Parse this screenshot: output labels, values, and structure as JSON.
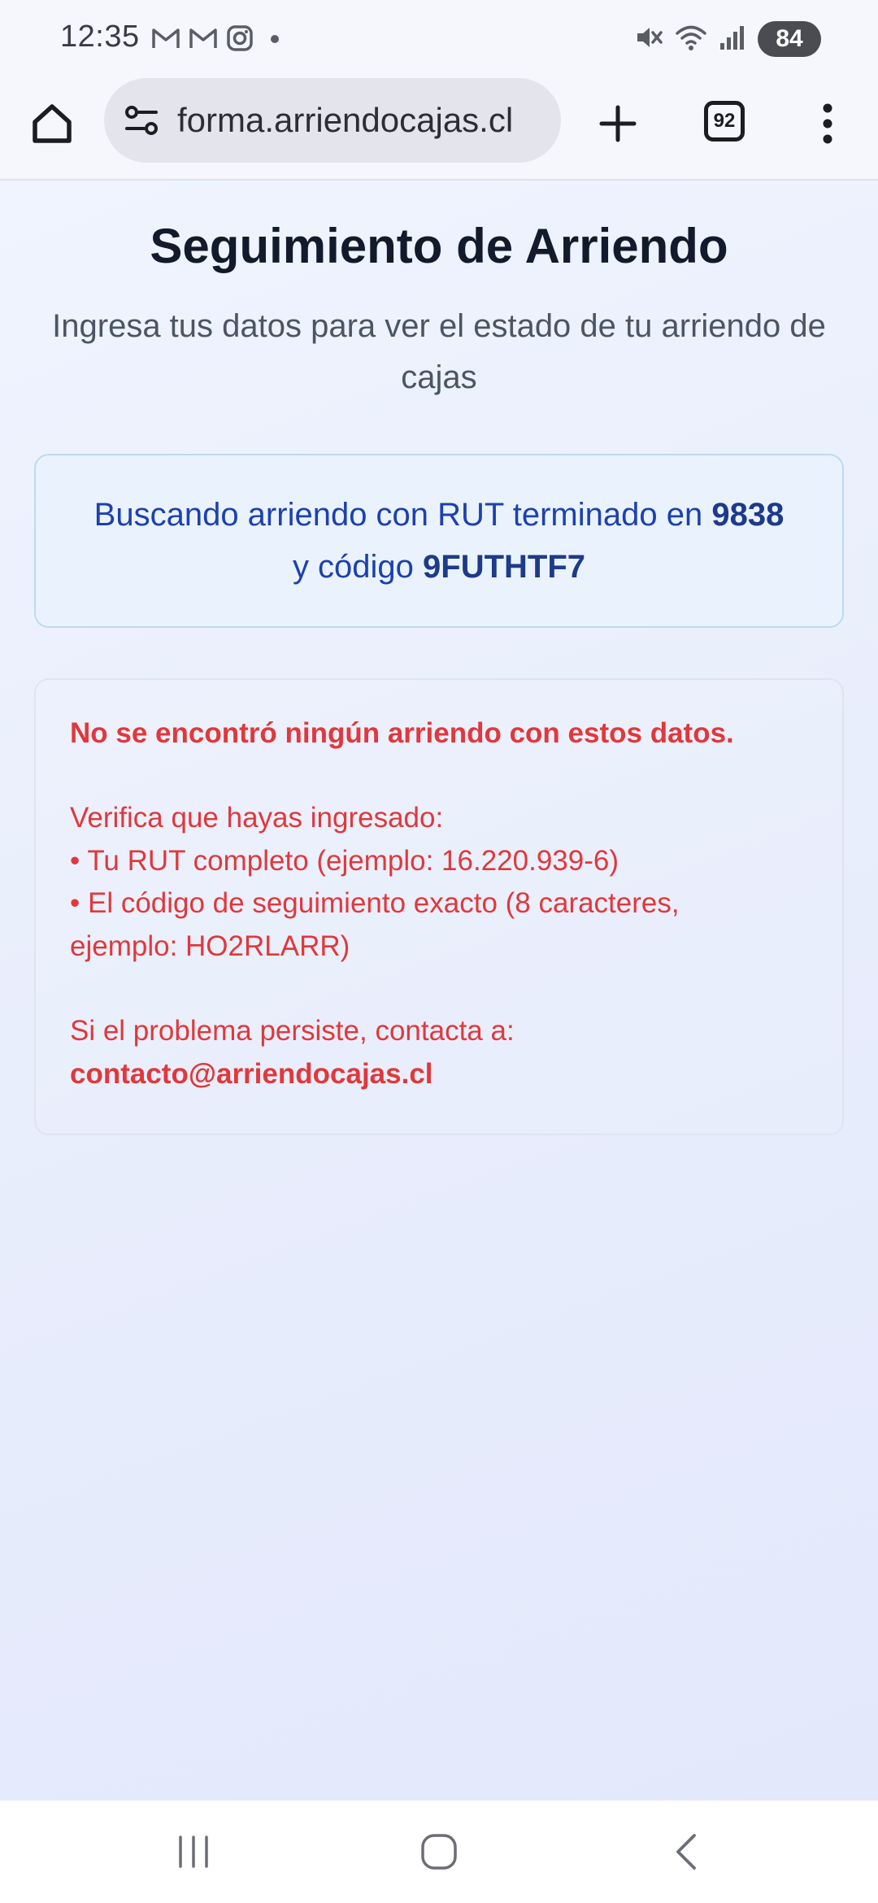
{
  "status_bar": {
    "time": "12:35",
    "notification_icons": [
      "gmail-icon",
      "gmail-icon",
      "instagram-icon",
      "dot-icon"
    ],
    "system_icons": [
      "mute-icon",
      "wifi-icon",
      "signal-icon"
    ],
    "battery": "84"
  },
  "browser": {
    "url": "forma.arriendocajas.cl",
    "tab_count": "92"
  },
  "page": {
    "title": "Seguimiento de Arriendo",
    "subtitle": "Ingresa tus datos para ver el estado de tu arriendo de cajas",
    "info": {
      "prefix": "Buscando arriendo con RUT terminado en ",
      "rut_suffix": "9838",
      "middle": " y código ",
      "code": "9FUTHTF7"
    },
    "error": {
      "heading": "No se encontró ningún arriendo con estos datos.",
      "verify_intro": "Verifica que hayas ingresado:",
      "bullet_1": "• Tu RUT completo (ejemplo: 16.220.939-6)",
      "bullet_2_line_1": "• El código de seguimiento exacto (8 caracteres,",
      "bullet_2_line_2": "ejemplo: HO2RLARR)",
      "contact_intro": "Si el problema persiste, contacta a:",
      "contact_email": "contacto@arriendocajas.cl"
    }
  },
  "colors": {
    "error_red": "#e0383c",
    "info_blue": "#1e40af",
    "title_dark": "#121a2c"
  }
}
